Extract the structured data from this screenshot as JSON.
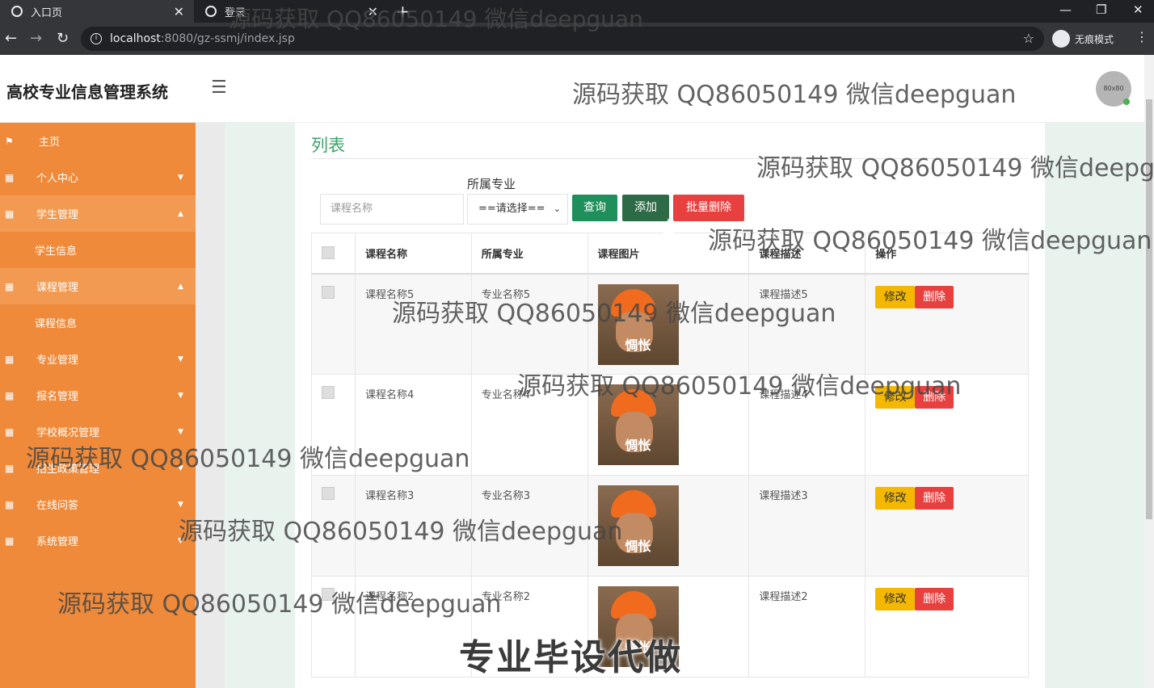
{
  "browser": {
    "tabs": [
      {
        "title": "入口页"
      },
      {
        "title": "登录"
      }
    ],
    "url_host": "localhost",
    "url_path": ":8080/gz-ssmj/index.jsp",
    "incognito_label": "无痕模式"
  },
  "header": {
    "title": "高校专业信息管理系统",
    "avatar_text": "80x80"
  },
  "sidebar": {
    "items": [
      {
        "label": "主页"
      },
      {
        "label": "个人中心"
      },
      {
        "label": "学生管理"
      },
      {
        "label": "学生信息"
      },
      {
        "label": "课程管理"
      },
      {
        "label": "课程信息"
      },
      {
        "label": "专业管理"
      },
      {
        "label": "报名管理"
      },
      {
        "label": "学校概况管理"
      },
      {
        "label": "招生政策管理"
      },
      {
        "label": "在线问答"
      },
      {
        "label": "系统管理"
      }
    ]
  },
  "main": {
    "panel_title": "列表",
    "search_placeholder": "课程名称",
    "filter_label": "所属专业",
    "filter_selected": "==请选择==",
    "buttons": {
      "query": "查询",
      "add": "添加",
      "batch_delete": "批量删除"
    },
    "table": {
      "headers": [
        "课程名称",
        "所属专业",
        "课程图片",
        "课程描述",
        "操作"
      ],
      "rows": [
        {
          "name": "课程名称5",
          "major": "专业名称5",
          "image_caption": "惆怅",
          "desc": "课程描述5"
        },
        {
          "name": "课程名称4",
          "major": "专业名称4",
          "image_caption": "惆怅",
          "desc": "课程描述4"
        },
        {
          "name": "课程名称3",
          "major": "专业名称3",
          "image_caption": "惆怅",
          "desc": "课程描述3"
        },
        {
          "name": "课程名称2",
          "major": "专业名称2",
          "image_caption": "惆怅",
          "desc": "课程描述2"
        }
      ],
      "edit_label": "修改",
      "delete_label": "删除"
    }
  },
  "watermarks": {
    "text": "源码获取 QQ86050149 微信deepguan",
    "big_text": "专业毕设代做"
  },
  "colors": {
    "sidebar": "#ef8a3a",
    "accent_green": "#3aa26a",
    "query_button": "#1f8f5b",
    "add_button": "#2d6b46",
    "delete_button": "#e8403f",
    "edit_button": "#f5b800"
  }
}
